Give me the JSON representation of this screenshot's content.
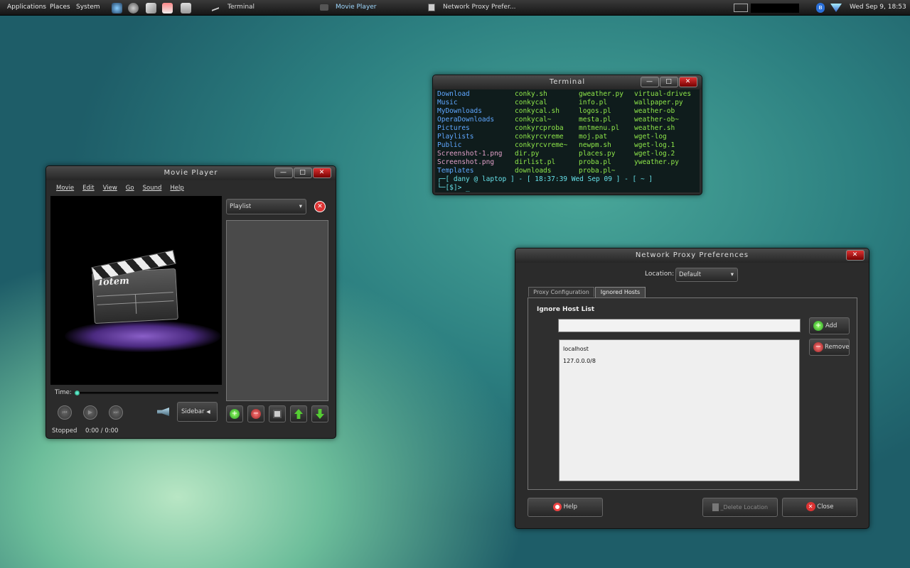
{
  "panel": {
    "menus": [
      "Applications",
      "Places",
      "System"
    ],
    "tasks": [
      {
        "label": "Terminal"
      },
      {
        "label": "Movie Player"
      },
      {
        "label": "Network Proxy Prefer..."
      }
    ],
    "clock": "Wed Sep  9, 18:53"
  },
  "terminal": {
    "title": "Terminal",
    "col1": [
      "Download",
      "Music",
      "MyDownloads",
      "OperaDownloads",
      "Pictures",
      "Playlists",
      "Public",
      "Screenshot-1.png",
      "Screenshot.png",
      "Templates"
    ],
    "col2": [
      "conky.sh",
      "conkycal",
      "conkycal.sh",
      "conkycal~",
      "conkyrcproba",
      "conkyrcvreme",
      "conkyrcvreme~",
      "dir.py",
      "dirlist.pl",
      "downloads"
    ],
    "col3": [
      "gweather.py",
      "info.pl",
      "logos.pl",
      "mesta.pl",
      "mntmenu.pl",
      "moj.pat",
      "newpm.sh",
      "places.py",
      "proba.pl",
      "proba.pl~"
    ],
    "col4": [
      "virtual-drives",
      "wallpaper.py",
      "weather-ob",
      "weather-ob~",
      "weather.sh",
      "wget-log",
      "wget-log.1",
      "wget-log.2",
      "yweather.py"
    ],
    "prompt1": "┌─[ dany @ laptop ] - [ 18:37:39 Wed Sep 09 ] - [ ~ ]",
    "prompt2": "└─[$]> _"
  },
  "totem": {
    "title": "Movie Player",
    "menus": [
      "Movie",
      "Edit",
      "View",
      "Go",
      "Sound",
      "Help"
    ],
    "logo_text": "Totem",
    "sidebar_select": "Playlist",
    "time_label": "Time:",
    "sidebar_button": "Sidebar",
    "status": "Stopped",
    "time": "0:00 / 0:00"
  },
  "proxy": {
    "title": "Network Proxy Preferences",
    "location_label": "Location:",
    "location_value": "Default",
    "tabs": [
      "Proxy Configuration",
      "Ignored Hosts"
    ],
    "section_title": "Ignore Host List",
    "add_label": "Add",
    "remove_label": "Remove",
    "hosts": [
      "localhost",
      "127.0.0.0/8"
    ],
    "help_label": "Help",
    "delete_label": "_Delete Location",
    "close_label": "Close"
  }
}
